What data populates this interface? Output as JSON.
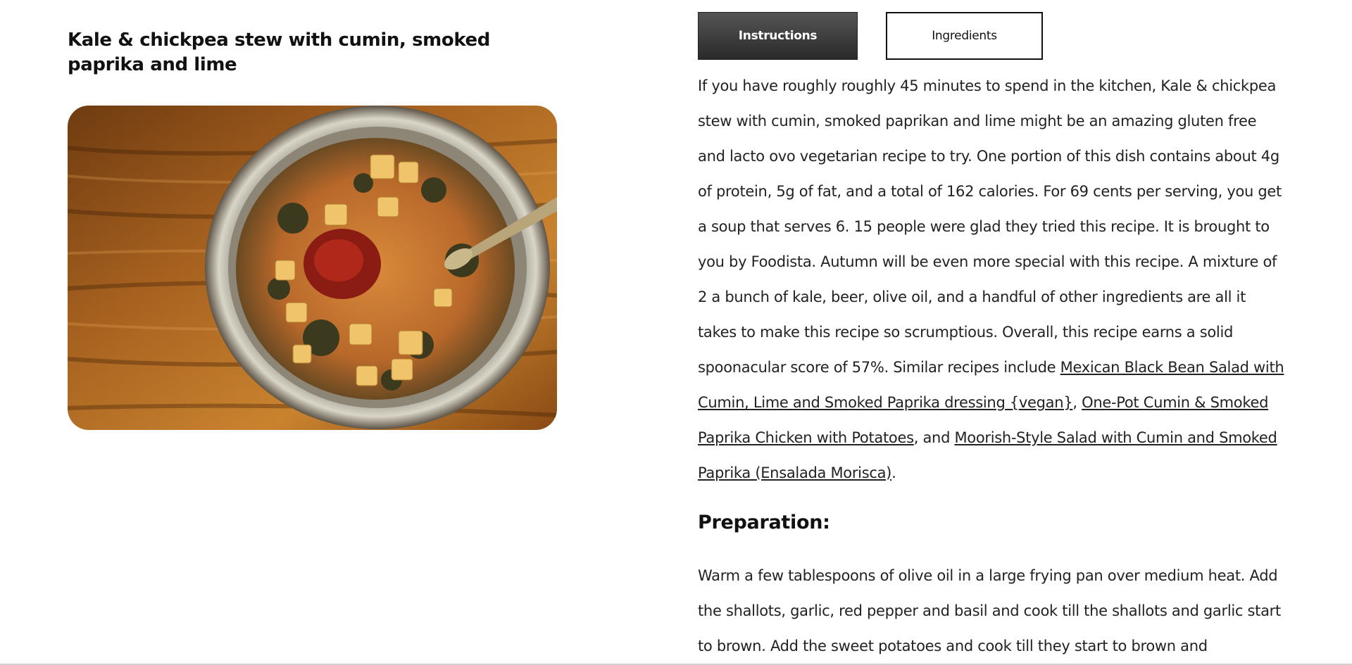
{
  "recipe": {
    "title": "Kale & chickpea stew with cumin, smoked paprika and lime",
    "image_alt": "Kale & chickpea stew in a ceramic bowl"
  },
  "tabs": {
    "instructions_label": "Instructions",
    "ingredients_label": "Ingredients"
  },
  "summary": {
    "text": "If you have roughly roughly 45 minutes to spend in the kitchen, Kale & chickpea stew with cumin, smoked paprikan and lime might be an amazing gluten free and lacto ovo vegetarian recipe to try. One portion of this dish contains about 4g of protein, 5g of fat, and a total of 162 calories. For 69 cents per serving, you get a soup that serves 6. 15 people were glad they tried this recipe. It is brought to you by Foodista. Autumn will be even more special with this recipe. A mixture of 2 a bunch of kale, beer, olive oil, and a handful of other ingredients are all it takes to make this recipe so scrumptious. Overall, this recipe earns a solid spoonacular score of 57%. Similar recipes include ",
    "link1": "Mexican Black Bean Salad with Cumin, Lime and Smoked Paprika dressing {vegan}",
    "sep1": ", ",
    "link2": "One-Pot Cumin & Smoked Paprika Chicken with Potatoes",
    "sep2": ", and ",
    "link3": "Moorish-Style Salad with Cumin and Smoked Paprika (Ensalada Morisca)",
    "end": "."
  },
  "preparation": {
    "heading": "Preparation:",
    "text": "Warm a few tablespoons of olive oil in a large frying pan over medium heat. Add the shallots, garlic, red pepper and basil and cook till the shallots and garlic start to brown. Add the sweet potatoes and cook till they start to brown and"
  }
}
